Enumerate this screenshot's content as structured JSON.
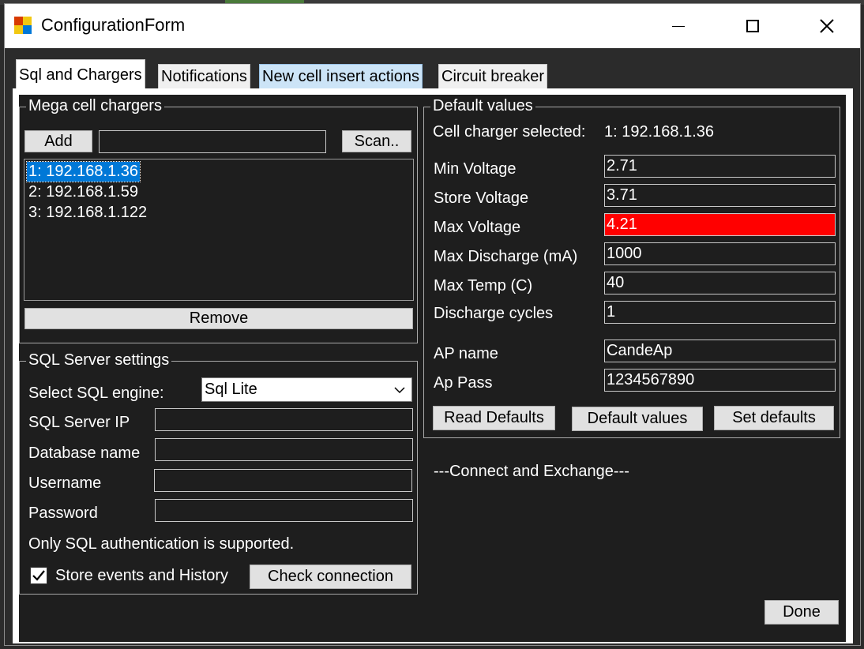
{
  "window": {
    "title": "ConfigurationForm"
  },
  "tabs": [
    {
      "label": "Sql and Chargers"
    },
    {
      "label": "Notifications"
    },
    {
      "label": "New cell insert actions"
    },
    {
      "label": "Circuit breaker"
    }
  ],
  "chargers": {
    "group_title": "Mega cell chargers",
    "add_label": "Add",
    "address_value": "",
    "scan_label": "Scan..",
    "items": [
      "1: 192.168.1.36",
      "2: 192.168.1.59",
      "3: 192.168.1.122"
    ],
    "remove_label": "Remove"
  },
  "sql": {
    "group_title": "SQL Server settings",
    "engine_label": "Select SQL engine:",
    "engine_value": "Sql Lite",
    "server_ip_label": "SQL Server IP",
    "server_ip_value": "",
    "database_label": "Database name",
    "database_value": "",
    "username_label": "Username",
    "username_value": "",
    "password_label": "Password",
    "password_value": "",
    "auth_note": "Only SQL authentication is supported.",
    "store_events_label": "Store events and History",
    "store_events_checked": true,
    "check_connection_label": "Check connection"
  },
  "defaults": {
    "group_title": "Default values",
    "selected_label": "Cell charger selected:",
    "selected_value": "1: 192.168.1.36",
    "fields": [
      {
        "label": "Min Voltage",
        "value": "2.71"
      },
      {
        "label": "Store Voltage",
        "value": "3.71"
      },
      {
        "label": "Max Voltage",
        "value": "4.21",
        "highlight": "#ff0000"
      },
      {
        "label": "Max Discharge (mA)",
        "value": "1000"
      },
      {
        "label": "Max Temp (C)",
        "value": "40"
      },
      {
        "label": "Discharge cycles",
        "value": "1"
      },
      {
        "label": "AP name",
        "value": "CandeAp"
      },
      {
        "label": "Ap Pass",
        "value": "1234567890"
      }
    ],
    "read_label": "Read Defaults",
    "default_values_label": "Default values",
    "set_label": "Set defaults"
  },
  "connect_text": "---Connect and Exchange---",
  "done_label": "Done"
}
